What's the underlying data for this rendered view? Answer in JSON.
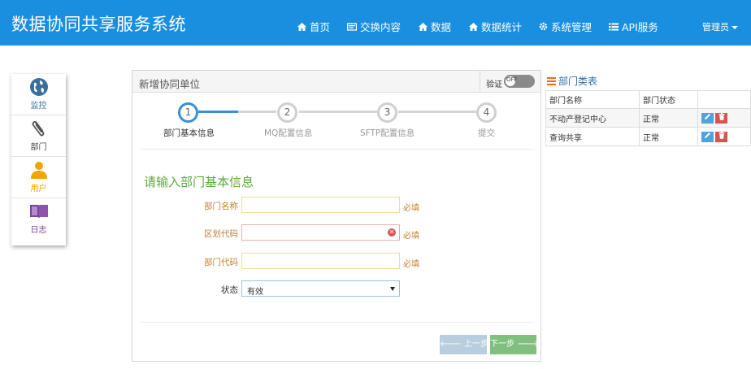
{
  "app": {
    "title": "数据协同共享服务系统"
  },
  "nav": {
    "items": [
      {
        "label": "首页",
        "icon": "home-icon"
      },
      {
        "label": "交换内容",
        "icon": "card-icon"
      },
      {
        "label": "数据",
        "icon": "home-icon"
      },
      {
        "label": "数据统计",
        "icon": "home-icon"
      },
      {
        "label": "系统管理",
        "icon": "gear-icon"
      },
      {
        "label": "API服务",
        "icon": "list-icon"
      }
    ],
    "user": "管理员"
  },
  "sidebar": {
    "items": [
      {
        "label": "监控",
        "icon": "globe-icon",
        "color": "#3a6f9c"
      },
      {
        "label": "部门",
        "icon": "paperclip-icon",
        "color": "#555555"
      },
      {
        "label": "用户",
        "icon": "user-icon",
        "color": "#f1a501"
      },
      {
        "label": "日志",
        "icon": "book-icon",
        "color": "#7b4399"
      }
    ]
  },
  "panel": {
    "title": "新增协同单位",
    "verify_label": "验证",
    "toggle_text": "OFF"
  },
  "wizard": {
    "steps": [
      {
        "num": "1",
        "label": "部门基本信息",
        "active": true
      },
      {
        "num": "2",
        "label": "MQ配置信息",
        "active": false
      },
      {
        "num": "3",
        "label": "SFTP配置信息",
        "active": false
      },
      {
        "num": "4",
        "label": "提交",
        "active": false
      }
    ]
  },
  "form": {
    "title": "请输入部门基本信息",
    "fields": [
      {
        "label": "部门名称",
        "value": "",
        "required": "必填"
      },
      {
        "label": "区划代码",
        "value": "",
        "required": "必填"
      },
      {
        "label": "部门代码",
        "value": "",
        "required": "必填"
      }
    ],
    "status": {
      "label": "状态",
      "value": "有效"
    },
    "prev_label": "上一步",
    "next_label": "下一步"
  },
  "dept_list": {
    "title": "部门类表",
    "columns": [
      "部门名称",
      "部门状态",
      ""
    ],
    "rows": [
      {
        "name": "不动产登记中心",
        "status": "正常"
      },
      {
        "name": "查询共享",
        "status": "正常"
      }
    ]
  },
  "colors": {
    "topbar": "#1a8fe0",
    "wizard_active": "#3a8fd8",
    "form_title": "#5cab3c",
    "required": "#c58030",
    "next_button": "#80c07f",
    "prev_button": "#b8cddd",
    "edit_button": "#4ea2dd",
    "delete_button": "#d9534f"
  }
}
